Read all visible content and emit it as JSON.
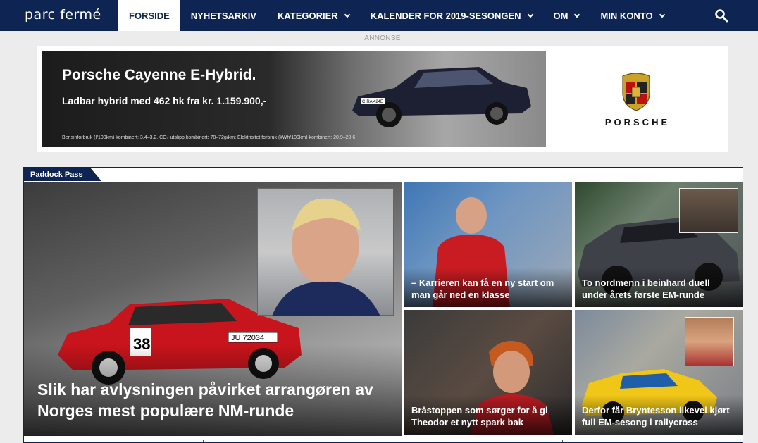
{
  "nav": {
    "logo": "parc fermé",
    "items": [
      {
        "label": "FORSIDE",
        "active": true,
        "dropdown": false
      },
      {
        "label": "NYHETSARKIV",
        "active": false,
        "dropdown": false
      },
      {
        "label": "KATEGORIER",
        "active": false,
        "dropdown": true
      },
      {
        "label": "KALENDER FOR 2019-SESONGEN",
        "active": false,
        "dropdown": true
      },
      {
        "label": "OM",
        "active": false,
        "dropdown": true
      },
      {
        "label": "MIN KONTO",
        "active": false,
        "dropdown": true
      }
    ],
    "search_icon": "search-icon"
  },
  "ad": {
    "label": "ANNONSE",
    "title": "Porsche Cayenne E-Hybrid.",
    "subtitle": "Ladbar hybrid med 462 hk fra kr. 1.159.900,-",
    "fineprint": "Bensinforbruk (l/100km) kombinert: 3,4–3,2, CO₂-utslipp kombinert: 78–72g/km; Elektrisitet forbruk (kWh/100km) kombinert: 20,9–20,6",
    "plate": "C·RA 424E",
    "brand": "PORSCHE"
  },
  "section": {
    "tag": "Paddock Pass",
    "main": {
      "title": "Slik har avlysningen påvirket arrangøren av Norges mest populære NM-runde",
      "car_number": "38",
      "car_plate": "JU 72034"
    },
    "tiles": [
      {
        "title": "– Karrieren kan få en ny start om man går ned en klasse"
      },
      {
        "title": "To nordmenn i beinhard duell under årets første EM-runde"
      },
      {
        "title": "Bråstoppen som sørger for å gi Theodor et nytt spark bak"
      },
      {
        "title": "Derfor får Bryntesson likevel kjørt full EM-sesong i rallycross"
      }
    ]
  },
  "colors": {
    "nav_bg": "#0e2452",
    "accent": "#0e2452",
    "page_bg": "#ececec"
  }
}
